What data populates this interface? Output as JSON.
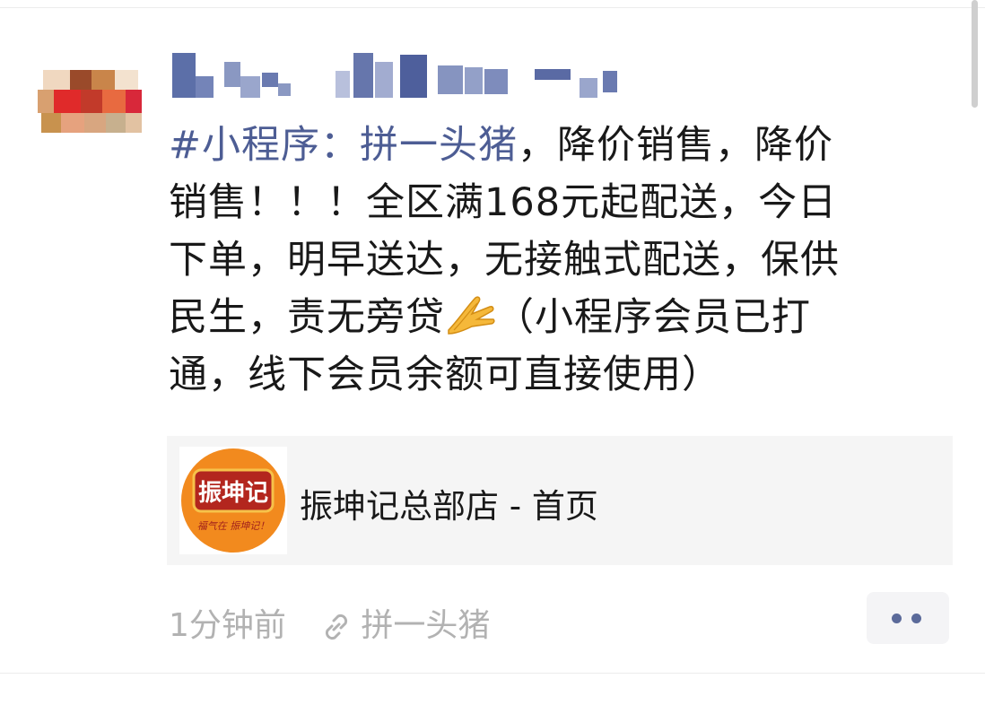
{
  "post": {
    "author_name": "",
    "topic": "#小程序：拼一头猪",
    "body_lines": [
      "，降价销售，降价",
      "销售！！！全区满168元起配送，今日",
      "下单，明早送达，无接触式配送，保供",
      "民生，责无旁贷",
      "（小程序会员已打",
      "通，线下会员余额可直接使用）"
    ],
    "emoji": "pray-hands"
  },
  "link_card": {
    "title": "振坤记总部店 - 首页",
    "logo_text": "振坤记",
    "logo_sub": "福气在 振坤记！"
  },
  "meta": {
    "time_ago": "1分钟前",
    "source": "拼一头猪"
  },
  "colors": {
    "link_blue": "#4d5d94",
    "text": "#191919",
    "meta_gray": "#b2b2b2",
    "card_bg": "#f5f5f5",
    "logo_orange": "#f28a1e",
    "logo_red": "#b3261e"
  }
}
